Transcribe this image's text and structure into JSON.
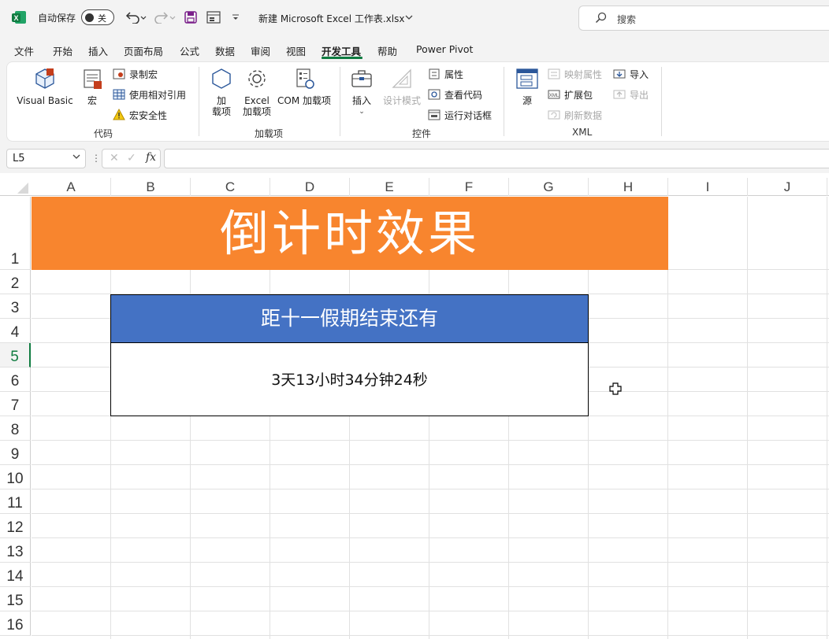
{
  "titlebar": {
    "autosave_label": "自动保存",
    "autosave_state": "关",
    "doc_title": "新建 Microsoft Excel 工作表.xlsx",
    "search_placeholder": "搜索"
  },
  "tabs": [
    "文件",
    "开始",
    "插入",
    "页面布局",
    "公式",
    "数据",
    "审阅",
    "视图",
    "开发工具",
    "帮助",
    "Power Pivot"
  ],
  "active_tab": "开发工具",
  "ribbon": {
    "code": {
      "label": "代码",
      "visual_basic": "Visual Basic",
      "macros": "宏",
      "record_macro": "录制宏",
      "relative_refs": "使用相对引用",
      "macro_security": "宏安全性"
    },
    "addins": {
      "label": "加载项",
      "addins_line1": "加",
      "addins_line2": "载项",
      "excel_addins_line1": "Excel",
      "excel_addins_line2": "加载项",
      "com_addins": "COM 加载项"
    },
    "controls": {
      "label": "控件",
      "insert": "插入",
      "design_mode": "设计模式",
      "properties": "属性",
      "view_code": "查看代码",
      "run_dialog": "运行对话框"
    },
    "xml": {
      "label": "XML",
      "source": "源",
      "map_properties": "映射属性",
      "expansion_packs": "扩展包",
      "refresh_data": "刷新数据",
      "import": "导入",
      "export": "导出"
    }
  },
  "formula_bar": {
    "name_box": "L5",
    "formula": ""
  },
  "columns": [
    "A",
    "B",
    "C",
    "D",
    "E",
    "F",
    "G",
    "H",
    "I",
    "J"
  ],
  "rows": [
    "1",
    "2",
    "3",
    "4",
    "5",
    "6",
    "7",
    "8",
    "9",
    "10",
    "11",
    "12",
    "13",
    "14",
    "15",
    "16"
  ],
  "selected_row": "5",
  "sheet": {
    "banner_title": "倒计时效果",
    "countdown_header": "距十一假期结束还有",
    "countdown_value": "3天13小时34分钟24秒"
  },
  "colors": {
    "banner": "#f8852e",
    "header_box": "#4472c4",
    "accent_green": "#107c41"
  }
}
